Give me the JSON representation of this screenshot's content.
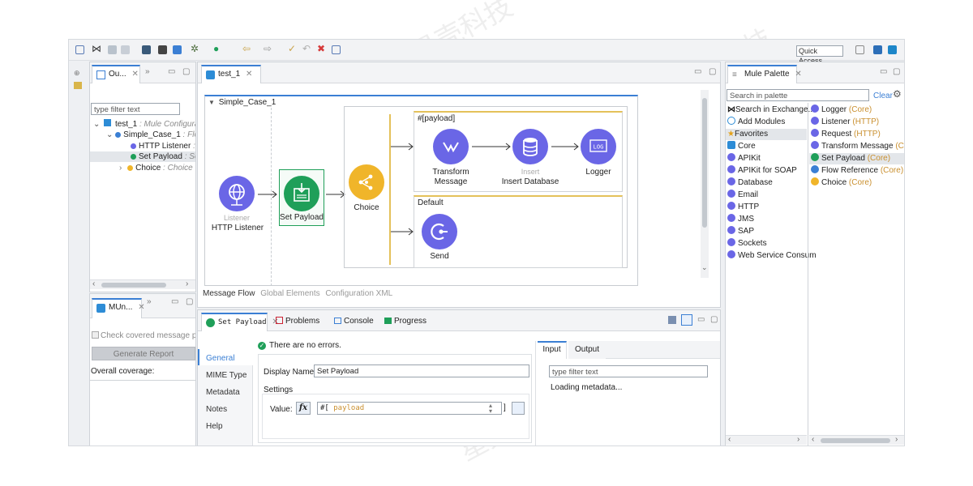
{
  "toolbar": {
    "quick_access": "Quick Access"
  },
  "outline": {
    "tab_label": "Ou...",
    "filter_placeholder": "type filter text",
    "rows": [
      {
        "label": "test_1",
        "sub": " : Mule Configurati"
      },
      {
        "label": "Simple_Case_1",
        "sub": " : Flov"
      },
      {
        "label": "HTTP Listener",
        "sub": " : L"
      },
      {
        "label": "Set Payload",
        "sub": " : Set"
      },
      {
        "label": "Choice",
        "sub": " : Choice"
      }
    ]
  },
  "munit": {
    "tab_label": "MUn...",
    "check_label": "Check covered message proce",
    "generate_label": "Generate Report",
    "coverage_label": "Overall coverage:"
  },
  "editor": {
    "tab_label": "test_1",
    "flow_name": "Simple_Case_1",
    "when_expr": "#[payload]",
    "default_label": "Default",
    "nodes": {
      "listener_small": "Listener",
      "listener": "HTTP Listener",
      "set_payload": "Set Payload",
      "choice": "Choice",
      "transform": "Transform\nMessage",
      "insert_small": "Insert",
      "insert": "Insert Database",
      "logger": "Logger",
      "send": "Send",
      "log_glyph": "LOG"
    },
    "bottom_tabs": [
      "Message Flow",
      "Global Elements",
      "Configuration XML"
    ]
  },
  "palette": {
    "tab_label": "Mule Palette",
    "search_placeholder": "Search in palette",
    "clear_label": "Clear",
    "modules": [
      "Search in Exchange...",
      "Add Modules",
      "Favorites",
      "Core",
      "APIKit",
      "APIKit for SOAP",
      "Database",
      "Email",
      "HTTP",
      "JMS",
      "SAP",
      "Sockets",
      "Web Service Consum"
    ],
    "favorites": [
      {
        "name": "Logger",
        "mod": "(Core)"
      },
      {
        "name": "Listener",
        "mod": "(HTTP)"
      },
      {
        "name": "Request",
        "mod": "(HTTP)"
      },
      {
        "name": "Transform Message",
        "mod": "(Core"
      },
      {
        "name": "Set Payload",
        "mod": "(Core)"
      },
      {
        "name": "Flow Reference",
        "mod": "(Core)"
      },
      {
        "name": "Choice",
        "mod": "(Core)"
      }
    ]
  },
  "props": {
    "tabs": [
      "Set Payload",
      "Problems",
      "Console",
      "Progress"
    ],
    "status": "There are no errors.",
    "nav": [
      "General",
      "MIME Type",
      "Metadata",
      "Notes",
      "Help"
    ],
    "display_name_label": "Display Name:",
    "display_name_value": "Set Payload",
    "settings_label": "Settings",
    "value_label": "Value:",
    "fx_label": "fx",
    "value_open": "#[",
    "value_text": " payload",
    "io_tabs": [
      "Input",
      "Output"
    ],
    "io_filter": "type filter text",
    "loading": "Loading metadata..."
  },
  "watermark": "星壳科技",
  "colors": {
    "accent": "#3b7fd4",
    "node_blue": "#6a66e6",
    "node_green": "#1f9f59",
    "node_yellow": "#f0b52a",
    "route_yellow": "#e4c15a"
  }
}
